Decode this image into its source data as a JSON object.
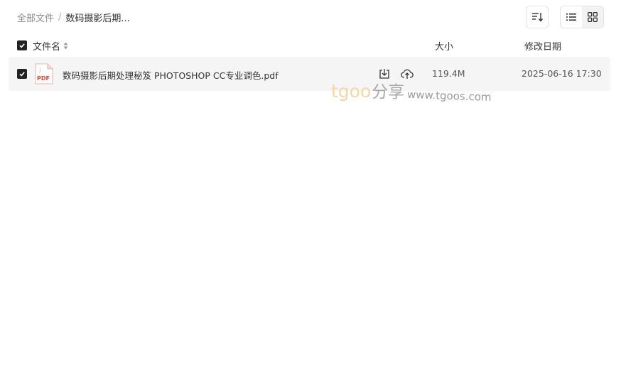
{
  "breadcrumb": {
    "root": "全部文件",
    "separator": "/",
    "current": "数码摄影后期..."
  },
  "toolbar": {
    "sort_icon": "sort-lines-icon",
    "view_list_icon": "list-view-icon",
    "view_grid_icon": "grid-view-icon",
    "active_view": "list"
  },
  "columns": {
    "name": "文件名",
    "size": "大小",
    "date": "修改日期"
  },
  "files": [
    {
      "name": "数码摄影后期处理秘笈 PHOTOSHOP CC专业调色.pdf",
      "type_icon": "pdf-file-icon",
      "type_label": "PDF",
      "size": "119.4M",
      "modified": "2025-06-16 17:30",
      "checked": true
    }
  ],
  "watermark": {
    "brand": "tgoo",
    "suffix": "分享",
    "url": "www.tgoos.com"
  },
  "colors": {
    "checkbox": "#222222",
    "row_highlight": "#f5f5f5",
    "pdf_red": "#e0413a",
    "watermark_brand": "#f3d7a4"
  }
}
